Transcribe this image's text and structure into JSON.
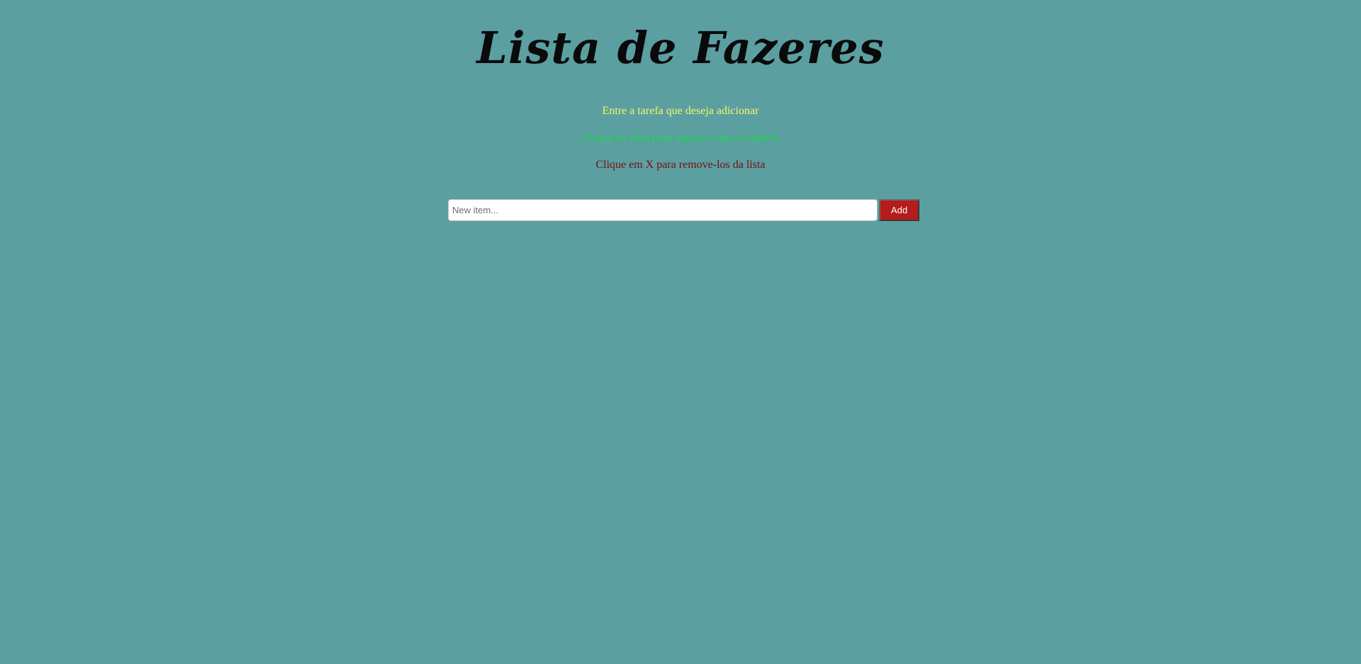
{
  "header": {
    "title": "Lista de Fazeres"
  },
  "instructions": {
    "add": "Entre a tarefa que deseja adicionar",
    "complete": "Clique no item para marcar como completa",
    "remove": "Clique em X para remove-los da lista"
  },
  "form": {
    "input_placeholder": "New item...",
    "input_value": "",
    "add_label": "Add"
  },
  "colors": {
    "background": "#5b9fa1",
    "instruction_add": "#f7f56a",
    "instruction_complete": "#1fd84a",
    "instruction_remove": "#7a0e0e",
    "add_button": "#b51c1c"
  }
}
